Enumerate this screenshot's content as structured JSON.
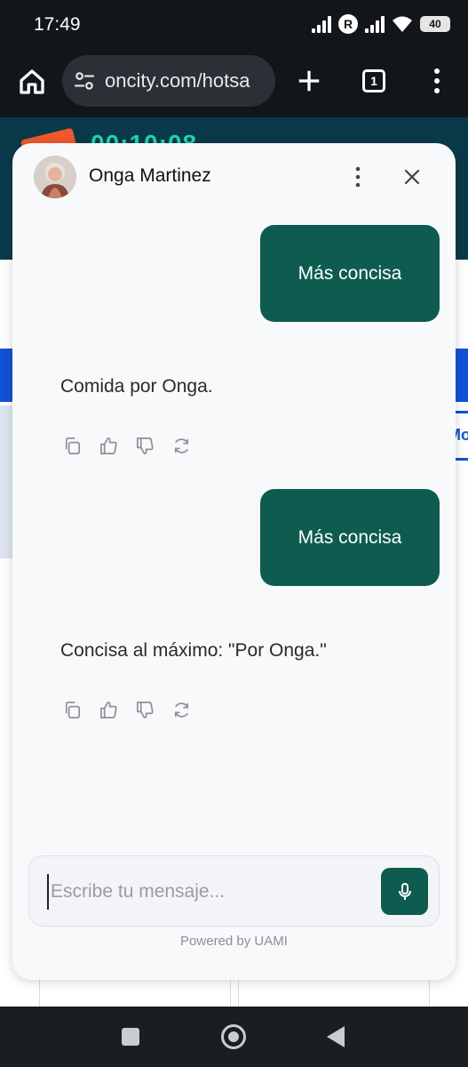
{
  "status_bar": {
    "time": "17:49",
    "battery": "40",
    "icons": [
      "signal-icon",
      "r-badge-icon",
      "signal-icon",
      "wifi-icon",
      "battery-icon"
    ]
  },
  "browser": {
    "url": "oncity.com/hotsa",
    "tab_count": "1",
    "icons": [
      "home-icon",
      "tune-icon",
      "plus-icon",
      "tabs-icon",
      "more-vert-icon"
    ]
  },
  "background_page": {
    "timer": "00:10:08",
    "side_button": "Mo",
    "colors": {
      "header": "#0a3a4a",
      "timer": "#21d4b0",
      "band": "#1252d6",
      "logo": "#f0592d"
    }
  },
  "chat": {
    "agent_name": "Onga Martinez",
    "messages": [
      {
        "role": "user",
        "text": "Más concisa"
      },
      {
        "role": "assistant",
        "text": "Comida por Onga."
      },
      {
        "role": "user",
        "text": "Más concisa"
      },
      {
        "role": "assistant",
        "text": "Concisa al máximo: \"Por Onga.\""
      }
    ],
    "message_actions": [
      "copy-icon",
      "thumbs-up-icon",
      "thumbs-down-icon",
      "refresh-icon"
    ],
    "composer": {
      "placeholder": "Escribe tu mensaje...",
      "value": ""
    },
    "powered_by": "Powered by UAMI",
    "colors": {
      "accent": "#0d5c4f",
      "panel": "#f8f9fb"
    }
  },
  "nav_bar": {
    "buttons": [
      "recents-icon",
      "home-circle-icon",
      "back-triangle-icon"
    ]
  }
}
